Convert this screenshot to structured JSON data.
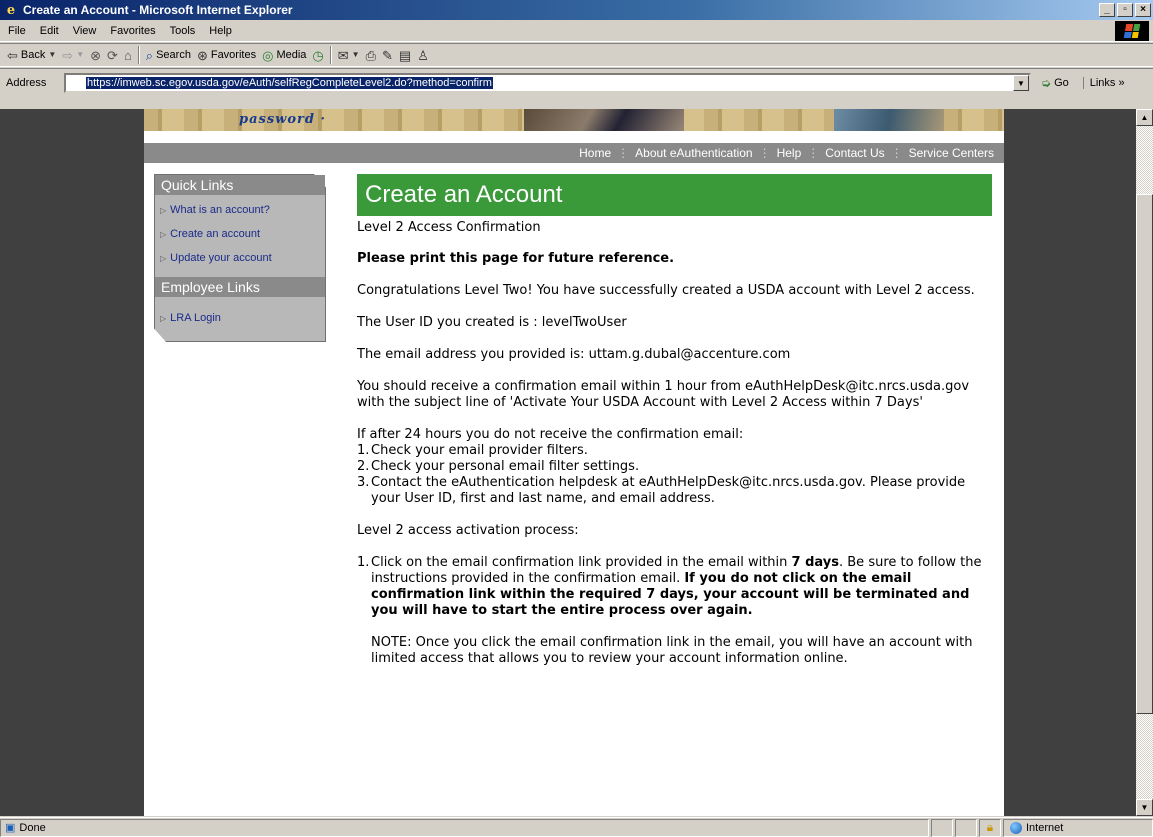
{
  "window": {
    "title": "Create an Account - Microsoft Internet Explorer",
    "buttons": [
      "_",
      "×"
    ]
  },
  "menubar": [
    "File",
    "Edit",
    "View",
    "Favorites",
    "Tools",
    "Help"
  ],
  "toolbar": {
    "back": "Back",
    "search": "Search",
    "favorites": "Favorites",
    "media": "Media"
  },
  "address": {
    "label": "Address",
    "url": "https://imweb.sc.egov.usda.gov/eAuth/selfRegCompleteLevel2.do?method=confirm",
    "go": "Go",
    "links": "Links »"
  },
  "banner": {
    "password_text": "password ·"
  },
  "nav": [
    "Home",
    "About eAuthentication",
    "Help",
    "Contact Us",
    "Service Centers"
  ],
  "sidebar": {
    "quick_links_title": "Quick Links",
    "quick_links": [
      "What is an account?",
      "Create an account",
      "Update your account"
    ],
    "employee_links_title": "Employee Links",
    "employee_links": [
      "LRA Login"
    ]
  },
  "main": {
    "title": "Create an Account",
    "subtitle": "Level 2 Access Confirmation",
    "print_notice": "Please print this page for future reference.",
    "congrats": "Congratulations Level Two! You have successfully created a USDA account with Level 2 access.",
    "userid_text": "The User ID you created is : levelTwoUser",
    "email_text": "The email address you provided is: uttam.g.dubal@accenture.com",
    "confirmation_text": "You should receive a confirmation email within 1 hour from eAuthHelpDesk@itc.nrcs.usda.gov with the subject line of 'Activate Your USDA Account with Level 2 Access within 7 Days'",
    "if_after": "If after 24 hours you do not receive the confirmation email:",
    "steps": [
      {
        "num": "1.",
        "text": "Check your email provider filters."
      },
      {
        "num": "2.",
        "text": "Check your personal email filter settings."
      },
      {
        "num": "3.",
        "text": "Contact the eAuthentication helpdesk at eAuthHelpDesk@itc.nrcs.usda.gov. Please provide your User ID, first and last name, and email address."
      }
    ],
    "activation_title": "Level 2 access activation process:",
    "activation_step1_num": "1.",
    "activation_step1_a": "Click on the email confirmation link provided in the email within ",
    "activation_step1_b": "7 days",
    "activation_step1_c": ". Be sure to follow the instructions provided in the confirmation email. ",
    "activation_step1_d": "If you do not click on the email confirmation link within the required 7 days, your account will be terminated and you will have to start the entire process over again.",
    "note": "NOTE: Once you click the email confirmation link in the email, you will have an account with limited access that allows you to review your account information online."
  },
  "status": {
    "text": "Done",
    "zone": "Internet"
  }
}
